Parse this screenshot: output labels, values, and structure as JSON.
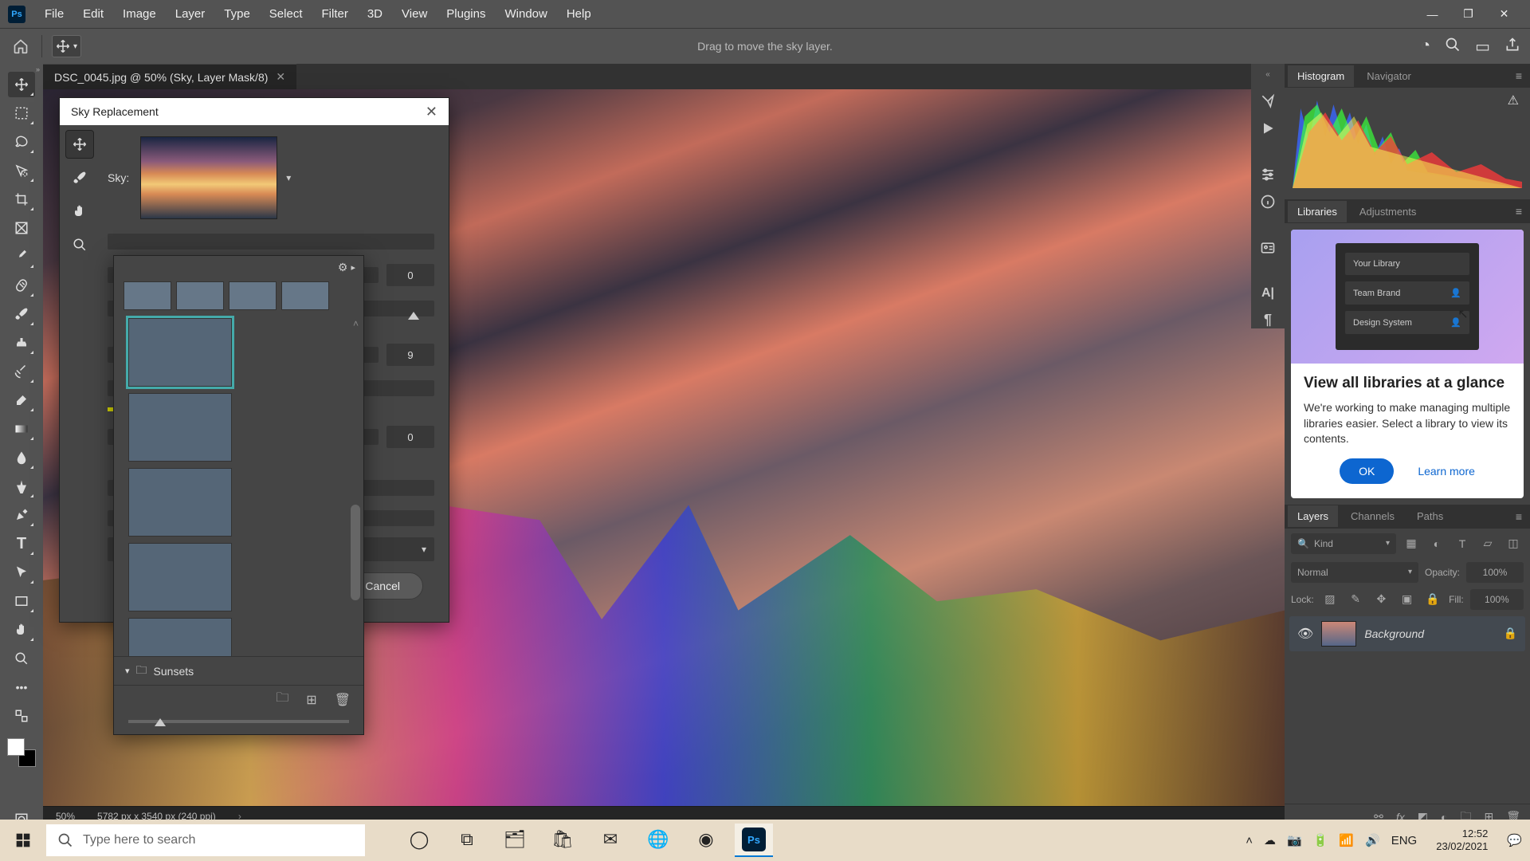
{
  "app": {
    "name": "Ps"
  },
  "menu": {
    "items": [
      "File",
      "Edit",
      "Image",
      "Layer",
      "Type",
      "Select",
      "Filter",
      "3D",
      "View",
      "Plugins",
      "Window",
      "Help"
    ]
  },
  "options": {
    "hint": "Drag to move the sky layer."
  },
  "doc": {
    "tab": "DSC_0045.jpg @ 50% (Sky, Layer Mask/8)"
  },
  "status": {
    "zoom": "50%",
    "dims": "5782 px x 3540 px (240 ppi)"
  },
  "dialog": {
    "title": "Sky Replacement",
    "sky_label": "Sky:",
    "val1": "0",
    "val2": "9",
    "val3": "0",
    "cancel": "Cancel",
    "picker": {
      "folder": "Sunsets"
    }
  },
  "panels": {
    "histogram": "Histogram",
    "navigator": "Navigator",
    "libraries": "Libraries",
    "adjustments": "Adjustments",
    "channels": "Channels",
    "paths": "Paths",
    "layers": "Layers"
  },
  "libraries_card": {
    "row1": "Your Library",
    "row2": "Team Brand",
    "row3": "Design System",
    "title": "View all libraries at a glance",
    "body": "We're working to make managing multiple libraries easier. Select a library to view its contents.",
    "ok": "OK",
    "learn": "Learn more"
  },
  "layers": {
    "kind": "Kind",
    "blend": "Normal",
    "opacity_label": "Opacity:",
    "opacity": "100%",
    "lock_label": "Lock:",
    "fill_label": "Fill:",
    "fill": "100%",
    "layer_name": "Background"
  },
  "taskbar": {
    "search_placeholder": "Type here to search",
    "lang": "ENG",
    "time": "12:52",
    "date": "23/02/2021"
  }
}
